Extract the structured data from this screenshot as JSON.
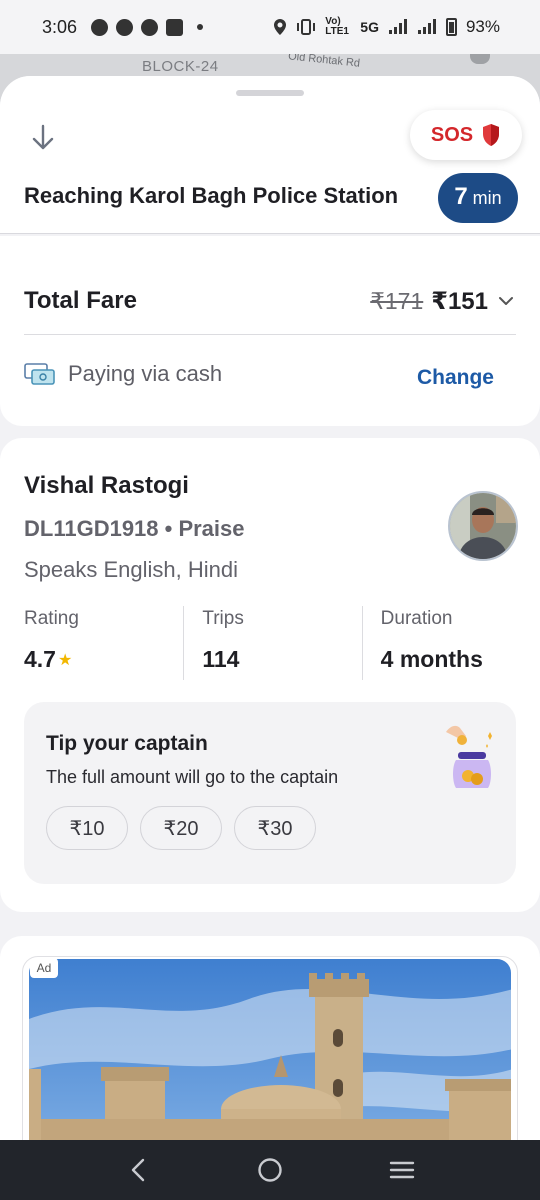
{
  "status_bar": {
    "time": "3:06",
    "network_label": "5G",
    "volte_label": "Vo) LTE1",
    "battery": "93%",
    "notification_icons": [
      "whatsapp-icon",
      "facebook-icon",
      "messenger-icon",
      "news-icon"
    ]
  },
  "map": {
    "block_label": "BLOCK-24",
    "road_label": "Old Rohtak Rd"
  },
  "header": {
    "sos_label": "SOS",
    "route_text": "Reaching Karol Bagh Police Station",
    "eta_value": "7",
    "eta_unit": "min"
  },
  "fare": {
    "label": "Total Fare",
    "original_amount": "₹171",
    "amount": "₹151",
    "payment_text": "Paying via cash",
    "change_label": "Change"
  },
  "captain": {
    "name": "Vishal Rastogi",
    "vehicle": "DL11GD1918 • Praise",
    "languages": "Speaks English, Hindi",
    "stats": [
      {
        "label": "Rating",
        "value": "4.7"
      },
      {
        "label": "Trips",
        "value": "114"
      },
      {
        "label": "Duration",
        "value": "4 months"
      }
    ]
  },
  "tip": {
    "title": "Tip your captain",
    "subtitle": "The full amount will go to the captain",
    "options": [
      "₹10",
      "₹20",
      "₹30"
    ]
  },
  "ad": {
    "badge": "Ad"
  },
  "colors": {
    "primary": "#1d4b86",
    "link": "#1d5aa6",
    "sos_red": "#d4272b",
    "star": "#f2b700"
  }
}
